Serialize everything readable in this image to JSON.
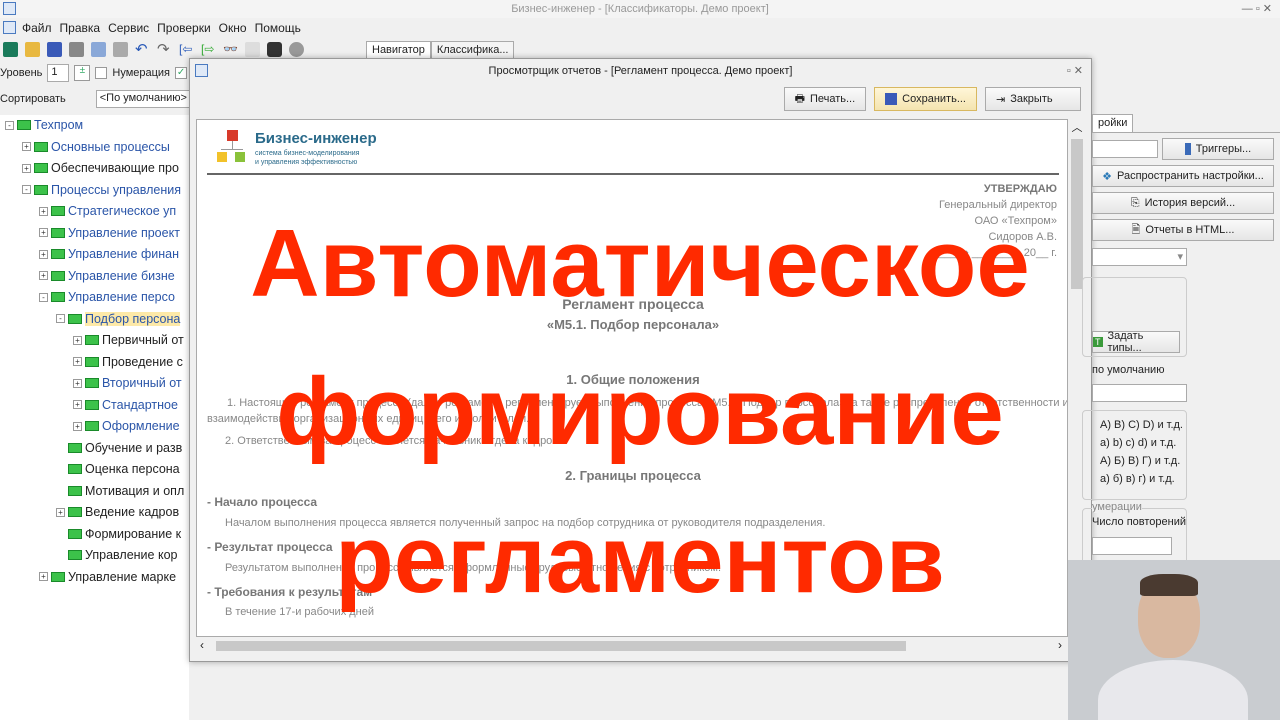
{
  "window": {
    "title": "Бизнес-инженер - [Классификаторы. Демо проект]"
  },
  "menu": [
    "Файл",
    "Правка",
    "Сервис",
    "Проверки",
    "Окно",
    "Помощь"
  ],
  "tabs": [
    "Навигатор",
    "Классифика..."
  ],
  "level": {
    "label": "Уровень",
    "value": "1",
    "numbering_label": "Нумерация",
    "numbering_checked": false,
    "second_checked": true
  },
  "sort": {
    "label": "Сортировать",
    "value": "<По умолчанию>"
  },
  "tree": [
    {
      "label": "Техпром",
      "level": 0,
      "exp": "-",
      "blue": true
    },
    {
      "label": "Основные процессы",
      "level": 1,
      "exp": "+",
      "blue": true
    },
    {
      "label": "Обеспечивающие про",
      "level": 1,
      "exp": "+",
      "blue": false
    },
    {
      "label": "Процессы управления",
      "level": 1,
      "exp": "-",
      "blue": true
    },
    {
      "label": "Стратегическое уп",
      "level": 2,
      "exp": "+",
      "blue": true
    },
    {
      "label": "Управление проект",
      "level": 2,
      "exp": "+",
      "blue": true
    },
    {
      "label": "Управление финан",
      "level": 2,
      "exp": "+",
      "blue": true
    },
    {
      "label": "Управление бизне",
      "level": 2,
      "exp": "+",
      "blue": true
    },
    {
      "label": "Управление персо",
      "level": 2,
      "exp": "-",
      "blue": true
    },
    {
      "label": "Подбор персона",
      "level": 3,
      "exp": "-",
      "blue": true,
      "selected": true
    },
    {
      "label": "Первичный от",
      "level": 4,
      "exp": "+",
      "blue": false
    },
    {
      "label": "Проведение с",
      "level": 4,
      "exp": "+",
      "blue": false
    },
    {
      "label": "Вторичный от",
      "level": 4,
      "exp": "+",
      "blue": true
    },
    {
      "label": "Стандартное",
      "level": 4,
      "exp": "+",
      "blue": true
    },
    {
      "label": "Оформление",
      "level": 4,
      "exp": "+",
      "blue": true
    },
    {
      "label": "Обучение и разв",
      "level": 3,
      "exp": "",
      "blue": false
    },
    {
      "label": "Оценка персона",
      "level": 3,
      "exp": "",
      "blue": false
    },
    {
      "label": "Мотивация и опл",
      "level": 3,
      "exp": "",
      "blue": false
    },
    {
      "label": "Ведение кадров",
      "level": 3,
      "exp": "+",
      "blue": false
    },
    {
      "label": "Формирование к",
      "level": 3,
      "exp": "",
      "blue": false
    },
    {
      "label": "Управление кор",
      "level": 3,
      "exp": "",
      "blue": false
    },
    {
      "label": "Управление марке",
      "level": 2,
      "exp": "+",
      "blue": false
    }
  ],
  "dialog": {
    "title": "Просмотрщик отчетов - [Регламент процесса. Демо проект]",
    "print": "Печать...",
    "save": "Сохранить...",
    "close": "Закрыть"
  },
  "doc": {
    "logo_title": "Бизнес-инженер",
    "logo_sub1": "система бизнес-моделирования",
    "logo_sub2": "и управления эффективностью",
    "approve": "УТВЕРЖДАЮ",
    "approve_role": "Генеральный директор",
    "approve_org": "ОАО «Техпром»",
    "approve_name": "Сидоров А.В.",
    "approve_date": "«____» ________ 20__ г.",
    "title": "Регламент процесса",
    "subtitle": "«М5.1. Подбор персонала»",
    "s1": "1. Общие положения",
    "p1": "1. Настоящий регламент процесса (далее регламент) регламентирует выполнение процесса «М5.1. Подбор персонала», а также распределение ответственности и",
    "p1b": "взаимодействия организационных единиц и его исполнителей.",
    "p2": "2. Ответственным за процесс является начальник отдела кадров",
    "s2": "2. Границы процесса",
    "h1": "- Начало процесса",
    "t1": "Началом выполнения процесса является полученный запрос на подбор сотрудника от руководителя подразделения.",
    "h2": "- Результат процесса",
    "t2": "Результатом выполнения процесса является оформленные трудовые отношения с сотрудником.",
    "h3": "- Требования к результатам",
    "t3": "В течение 17-и рабочих дней"
  },
  "right": {
    "tab": "ройки",
    "triggers": "Триггеры...",
    "spread": "Распространить настройки...",
    "history": "История версий...",
    "html": "Отчеты в HTML...",
    "types": "Задать типы...",
    "default": "по умолчанию",
    "opts": [
      "A) B) C) D) и т.д.",
      "a) b) c) d) и т.д.",
      "А) Б) В) Г) и т.д.",
      "а) б) в) г) и т.д."
    ],
    "numbering": "умерации",
    "repeat": "Число повторений"
  },
  "overlay": [
    "Автоматическое",
    "формирование",
    "регламентов"
  ]
}
